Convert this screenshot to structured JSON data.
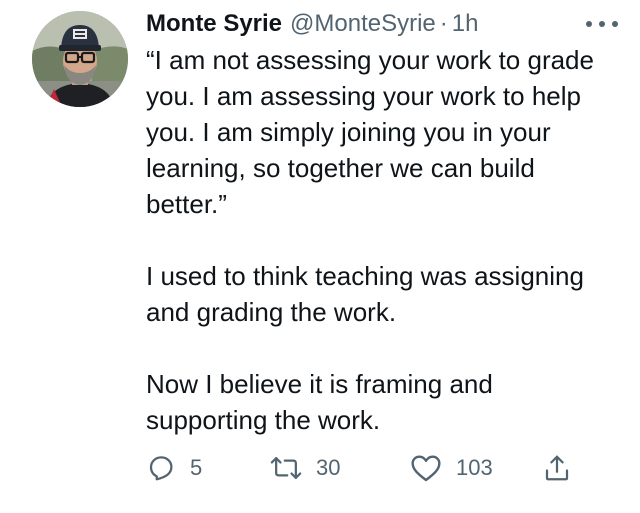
{
  "tweet": {
    "author_name": "Monte Syrie",
    "author_handle": "@MonteSyrie",
    "separator": "·",
    "time": "1h",
    "paragraphs": [
      "“I am not assessing your work to grade you. I am assessing your work to help you. I am simply joining you in your learning, so together we can build better.”",
      "I used to think teaching was assigning and grading the work.",
      "Now I believe it is framing and supporting the work."
    ]
  },
  "actions": {
    "reply_count": "5",
    "retweet_count": "30",
    "like_count": "103"
  },
  "icons": {
    "reply": "reply-icon",
    "retweet": "retweet-icon",
    "like": "heart-icon",
    "share": "share-icon",
    "more": "more-icon"
  },
  "colors": {
    "text": "#0f1419",
    "secondary": "#536471"
  }
}
